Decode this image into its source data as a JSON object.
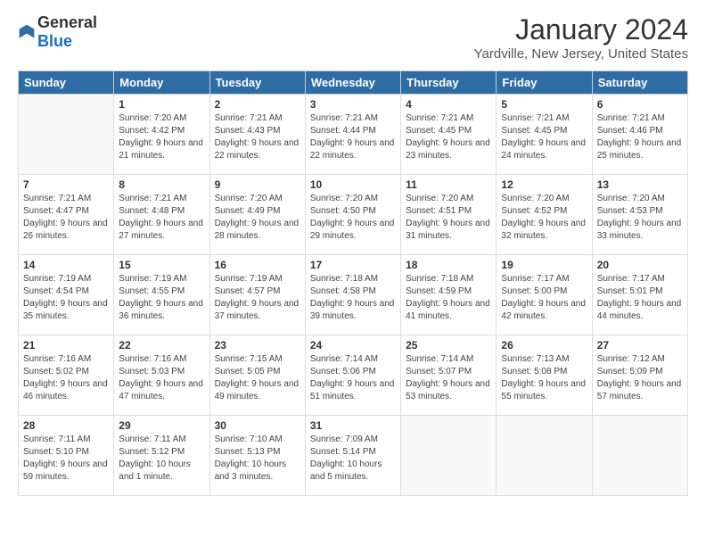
{
  "logo": {
    "general": "General",
    "blue": "Blue"
  },
  "title": "January 2024",
  "location": "Yardville, New Jersey, United States",
  "days_of_week": [
    "Sunday",
    "Monday",
    "Tuesday",
    "Wednesday",
    "Thursday",
    "Friday",
    "Saturday"
  ],
  "weeks": [
    [
      {
        "day": "",
        "sunrise": "",
        "sunset": "",
        "daylight": ""
      },
      {
        "day": "1",
        "sunrise": "Sunrise: 7:20 AM",
        "sunset": "Sunset: 4:42 PM",
        "daylight": "Daylight: 9 hours and 21 minutes."
      },
      {
        "day": "2",
        "sunrise": "Sunrise: 7:21 AM",
        "sunset": "Sunset: 4:43 PM",
        "daylight": "Daylight: 9 hours and 22 minutes."
      },
      {
        "day": "3",
        "sunrise": "Sunrise: 7:21 AM",
        "sunset": "Sunset: 4:44 PM",
        "daylight": "Daylight: 9 hours and 22 minutes."
      },
      {
        "day": "4",
        "sunrise": "Sunrise: 7:21 AM",
        "sunset": "Sunset: 4:45 PM",
        "daylight": "Daylight: 9 hours and 23 minutes."
      },
      {
        "day": "5",
        "sunrise": "Sunrise: 7:21 AM",
        "sunset": "Sunset: 4:45 PM",
        "daylight": "Daylight: 9 hours and 24 minutes."
      },
      {
        "day": "6",
        "sunrise": "Sunrise: 7:21 AM",
        "sunset": "Sunset: 4:46 PM",
        "daylight": "Daylight: 9 hours and 25 minutes."
      }
    ],
    [
      {
        "day": "7",
        "sunrise": "Sunrise: 7:21 AM",
        "sunset": "Sunset: 4:47 PM",
        "daylight": "Daylight: 9 hours and 26 minutes."
      },
      {
        "day": "8",
        "sunrise": "Sunrise: 7:21 AM",
        "sunset": "Sunset: 4:48 PM",
        "daylight": "Daylight: 9 hours and 27 minutes."
      },
      {
        "day": "9",
        "sunrise": "Sunrise: 7:20 AM",
        "sunset": "Sunset: 4:49 PM",
        "daylight": "Daylight: 9 hours and 28 minutes."
      },
      {
        "day": "10",
        "sunrise": "Sunrise: 7:20 AM",
        "sunset": "Sunset: 4:50 PM",
        "daylight": "Daylight: 9 hours and 29 minutes."
      },
      {
        "day": "11",
        "sunrise": "Sunrise: 7:20 AM",
        "sunset": "Sunset: 4:51 PM",
        "daylight": "Daylight: 9 hours and 31 minutes."
      },
      {
        "day": "12",
        "sunrise": "Sunrise: 7:20 AM",
        "sunset": "Sunset: 4:52 PM",
        "daylight": "Daylight: 9 hours and 32 minutes."
      },
      {
        "day": "13",
        "sunrise": "Sunrise: 7:20 AM",
        "sunset": "Sunset: 4:53 PM",
        "daylight": "Daylight: 9 hours and 33 minutes."
      }
    ],
    [
      {
        "day": "14",
        "sunrise": "Sunrise: 7:19 AM",
        "sunset": "Sunset: 4:54 PM",
        "daylight": "Daylight: 9 hours and 35 minutes."
      },
      {
        "day": "15",
        "sunrise": "Sunrise: 7:19 AM",
        "sunset": "Sunset: 4:55 PM",
        "daylight": "Daylight: 9 hours and 36 minutes."
      },
      {
        "day": "16",
        "sunrise": "Sunrise: 7:19 AM",
        "sunset": "Sunset: 4:57 PM",
        "daylight": "Daylight: 9 hours and 37 minutes."
      },
      {
        "day": "17",
        "sunrise": "Sunrise: 7:18 AM",
        "sunset": "Sunset: 4:58 PM",
        "daylight": "Daylight: 9 hours and 39 minutes."
      },
      {
        "day": "18",
        "sunrise": "Sunrise: 7:18 AM",
        "sunset": "Sunset: 4:59 PM",
        "daylight": "Daylight: 9 hours and 41 minutes."
      },
      {
        "day": "19",
        "sunrise": "Sunrise: 7:17 AM",
        "sunset": "Sunset: 5:00 PM",
        "daylight": "Daylight: 9 hours and 42 minutes."
      },
      {
        "day": "20",
        "sunrise": "Sunrise: 7:17 AM",
        "sunset": "Sunset: 5:01 PM",
        "daylight": "Daylight: 9 hours and 44 minutes."
      }
    ],
    [
      {
        "day": "21",
        "sunrise": "Sunrise: 7:16 AM",
        "sunset": "Sunset: 5:02 PM",
        "daylight": "Daylight: 9 hours and 46 minutes."
      },
      {
        "day": "22",
        "sunrise": "Sunrise: 7:16 AM",
        "sunset": "Sunset: 5:03 PM",
        "daylight": "Daylight: 9 hours and 47 minutes."
      },
      {
        "day": "23",
        "sunrise": "Sunrise: 7:15 AM",
        "sunset": "Sunset: 5:05 PM",
        "daylight": "Daylight: 9 hours and 49 minutes."
      },
      {
        "day": "24",
        "sunrise": "Sunrise: 7:14 AM",
        "sunset": "Sunset: 5:06 PM",
        "daylight": "Daylight: 9 hours and 51 minutes."
      },
      {
        "day": "25",
        "sunrise": "Sunrise: 7:14 AM",
        "sunset": "Sunset: 5:07 PM",
        "daylight": "Daylight: 9 hours and 53 minutes."
      },
      {
        "day": "26",
        "sunrise": "Sunrise: 7:13 AM",
        "sunset": "Sunset: 5:08 PM",
        "daylight": "Daylight: 9 hours and 55 minutes."
      },
      {
        "day": "27",
        "sunrise": "Sunrise: 7:12 AM",
        "sunset": "Sunset: 5:09 PM",
        "daylight": "Daylight: 9 hours and 57 minutes."
      }
    ],
    [
      {
        "day": "28",
        "sunrise": "Sunrise: 7:11 AM",
        "sunset": "Sunset: 5:10 PM",
        "daylight": "Daylight: 9 hours and 59 minutes."
      },
      {
        "day": "29",
        "sunrise": "Sunrise: 7:11 AM",
        "sunset": "Sunset: 5:12 PM",
        "daylight": "Daylight: 10 hours and 1 minute."
      },
      {
        "day": "30",
        "sunrise": "Sunrise: 7:10 AM",
        "sunset": "Sunset: 5:13 PM",
        "daylight": "Daylight: 10 hours and 3 minutes."
      },
      {
        "day": "31",
        "sunrise": "Sunrise: 7:09 AM",
        "sunset": "Sunset: 5:14 PM",
        "daylight": "Daylight: 10 hours and 5 minutes."
      },
      {
        "day": "",
        "sunrise": "",
        "sunset": "",
        "daylight": ""
      },
      {
        "day": "",
        "sunrise": "",
        "sunset": "",
        "daylight": ""
      },
      {
        "day": "",
        "sunrise": "",
        "sunset": "",
        "daylight": ""
      }
    ]
  ]
}
